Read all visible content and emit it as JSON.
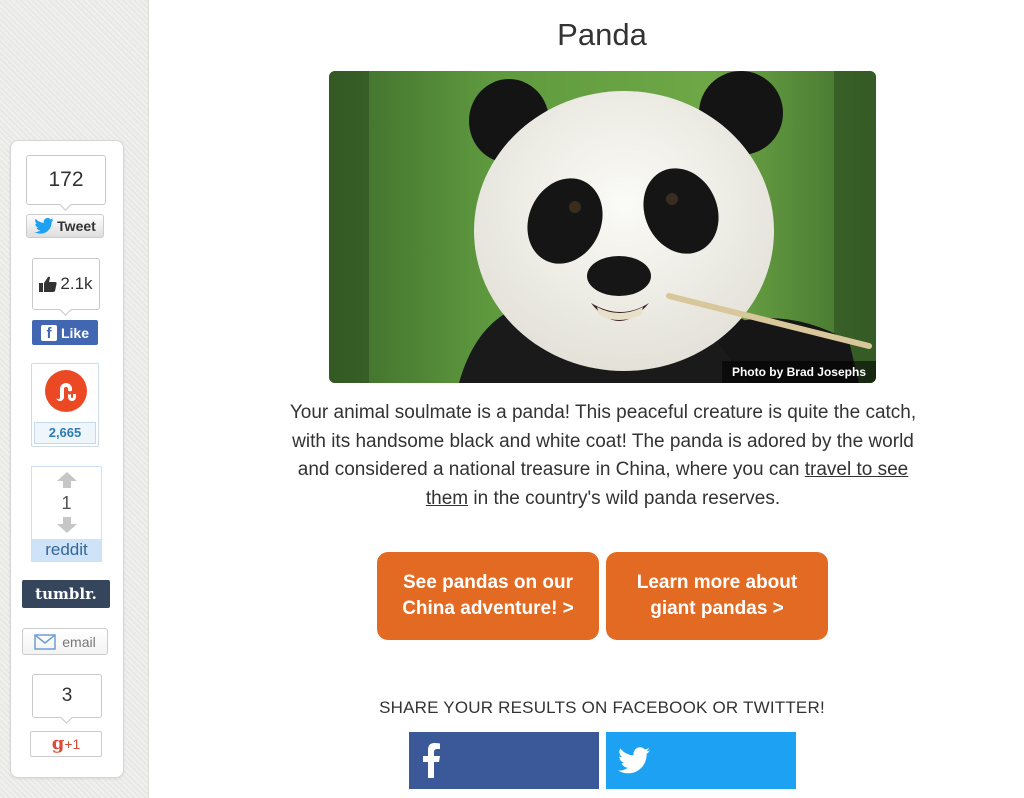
{
  "sidebar": {
    "twitter": {
      "count": "172",
      "label": "Tweet"
    },
    "facebook": {
      "count": "2.1k",
      "label": "Like"
    },
    "stumbleupon": {
      "count": "2,665"
    },
    "reddit": {
      "count": "1",
      "label": "reddit"
    },
    "tumblr": {
      "label": "tumblr."
    },
    "email": {
      "label": "email"
    },
    "gplus": {
      "count": "3",
      "label": "+1"
    }
  },
  "article": {
    "title": "Panda",
    "photo_credit": "Photo by Brad Josephs",
    "description_before": "Your animal soulmate is a panda! This peaceful creature is quite the catch, with its handsome black and white coat! The panda is adored by the world and considered a national treasure in China, where you can ",
    "description_link": "travel to see them",
    "description_after": " in the country's wild panda reserves.",
    "cta_left": "See pandas on our China adventure! >",
    "cta_right": "Learn more about giant pandas  >",
    "share_heading": "SHARE YOUR RESULTS ON FACEBOOK OR TWITTER!"
  },
  "colors": {
    "cta": "#e36a22",
    "facebook": "#3b5998",
    "twitter": "#1da1f2",
    "tumblr": "#35465c",
    "stumbleupon": "#eb4924"
  }
}
